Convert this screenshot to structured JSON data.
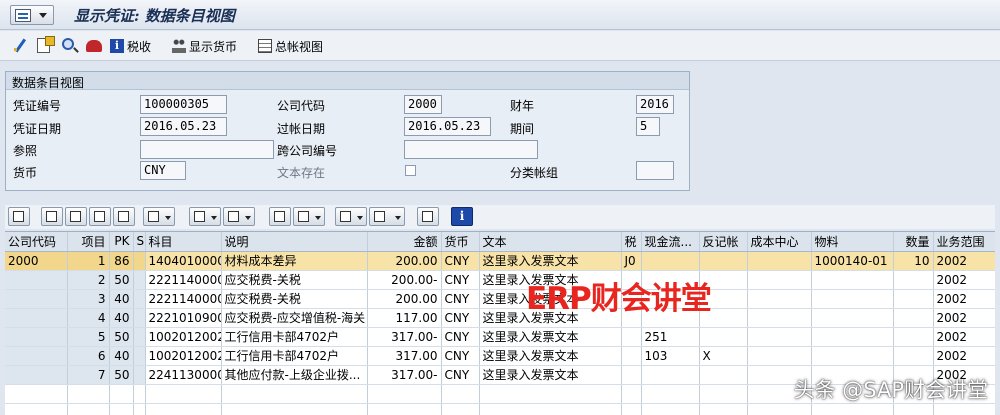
{
  "window": {
    "title": "显示凭证: 数据条目视图"
  },
  "toolbar": {
    "tax_label": "税收",
    "currency_label": "显示货币",
    "ledger_label": "总帐视图"
  },
  "header": {
    "section_title": "数据条目视图",
    "doc_no_label": "凭证编号",
    "doc_no": "100000305",
    "company_label": "公司代码",
    "company": "2000",
    "fiscal_year_label": "财年",
    "fiscal_year": "2016",
    "doc_date_label": "凭证日期",
    "doc_date": "2016.05.23",
    "post_date_label": "过帐日期",
    "post_date": "2016.05.23",
    "period_label": "期间",
    "period": "5",
    "ref_label": "参照",
    "ref": "",
    "cross_label": "跨公司编号",
    "cross": "",
    "currency_label": "货币",
    "currency": "CNY",
    "text_exists_label": "文本存在",
    "ledger_group_label": "分类帐组",
    "ledger_group": ""
  },
  "grid": {
    "columns": [
      "公司代码",
      "项目",
      "PK",
      "S",
      "科目",
      "说明",
      "金额",
      "货币",
      "文本",
      "税",
      "现金流...",
      "反记帐",
      "成本中心",
      "物料",
      "数量",
      "业务范围"
    ],
    "rows": [
      [
        "2000",
        "1",
        "86",
        "",
        "1404010000",
        "材料成本差异",
        "200.00",
        "CNY",
        "这里录入发票文本",
        "J0",
        "",
        "",
        "",
        "1000140-01",
        "10",
        "2002"
      ],
      [
        "",
        "2",
        "50",
        "",
        "2221140000",
        "应交税费-关税",
        "200.00-",
        "CNY",
        "这里录入发票文本",
        "",
        "",
        "",
        "",
        "",
        "",
        "2002"
      ],
      [
        "",
        "3",
        "40",
        "",
        "2221140000",
        "应交税费-关税",
        "200.00",
        "CNY",
        "这里录入发票文本",
        "",
        "",
        "",
        "",
        "",
        "",
        "2002"
      ],
      [
        "",
        "4",
        "40",
        "",
        "2221010900",
        "应交税费-应交增值税-海关",
        "117.00",
        "CNY",
        "这里录入发票文本",
        "",
        "",
        "",
        "",
        "",
        "",
        "2002"
      ],
      [
        "",
        "5",
        "50",
        "",
        "1002012002",
        "工行信用卡部4702户",
        "317.00-",
        "CNY",
        "这里录入发票文本",
        "",
        "251",
        "",
        "",
        "",
        "",
        "2002"
      ],
      [
        "",
        "6",
        "40",
        "",
        "1002012002",
        "工行信用卡部4702户",
        "317.00",
        "CNY",
        "这里录入发票文本",
        "",
        "103",
        "X",
        "",
        "",
        "",
        "2002"
      ],
      [
        "",
        "7",
        "50",
        "",
        "2241130000",
        "其他应付款-上级企业拨...",
        "317.00-",
        "CNY",
        "这里录入发票文本",
        "",
        "",
        "",
        "",
        "",
        "",
        "2002"
      ]
    ]
  },
  "overlay": {
    "watermark": "ERP财会讲堂",
    "credit": "头条 @SAP财会讲堂"
  }
}
